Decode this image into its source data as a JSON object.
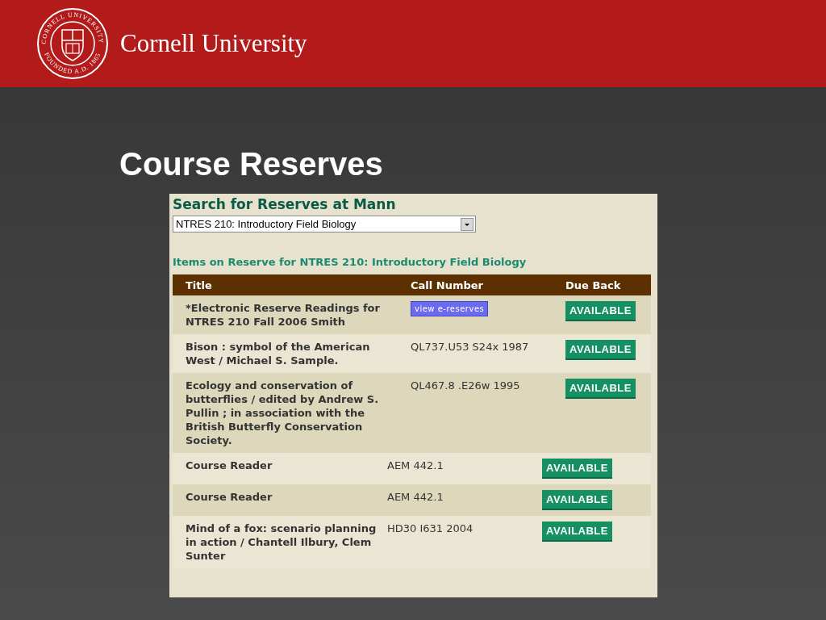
{
  "header": {
    "seal_text_top": "CORNELL UNIVERSITY",
    "seal_text_bottom": "FOUNDED A.D. 1865",
    "name": "Cornell University"
  },
  "slide_title": "Course Reserves",
  "page": {
    "heading": "Search for Reserves at Mann",
    "course_select": {
      "value": "NTRES 210: Introductory Field Biology"
    },
    "subheading": "Items on Reserve for NTRES 210: Introductory Field Biology",
    "table": {
      "columns": [
        "Title",
        "Call Number",
        "Due Back"
      ],
      "rows": [
        {
          "title": "*Electronic Reserve Readings for NTRES 210 Fall 2006 Smith",
          "call_number": {
            "kind": "link",
            "text": "view e-reserves"
          },
          "due_back": "AVAILABLE"
        },
        {
          "title": "Bison : symbol of the American West / Michael S. Sample.",
          "call_number": {
            "kind": "text",
            "text": "QL737.U53 S24x 1987"
          },
          "due_back": "AVAILABLE"
        },
        {
          "title": "Ecology and conservation of butterflies / edited by Andrew S. Pullin ; in association with the British Butterfly Conservation Society.",
          "call_number": {
            "kind": "text",
            "text": "QL467.8 .E26w 1995"
          },
          "due_back": "AVAILABLE"
        }
      ]
    },
    "table_continued": {
      "rows": [
        {
          "title": "Course Reader",
          "call_number": {
            "kind": "text",
            "text": "AEM 442.1"
          },
          "due_back": "AVAILABLE"
        },
        {
          "title": "Course Reader",
          "call_number": {
            "kind": "text",
            "text": "AEM 442.1"
          },
          "due_back": "AVAILABLE"
        },
        {
          "title": "Mind of a fox: scenario planning in action / Chantell Ilbury, Clem Sunter",
          "call_number": {
            "kind": "text",
            "text": "HD30 I631 2004"
          },
          "due_back": "AVAILABLE"
        }
      ]
    }
  }
}
